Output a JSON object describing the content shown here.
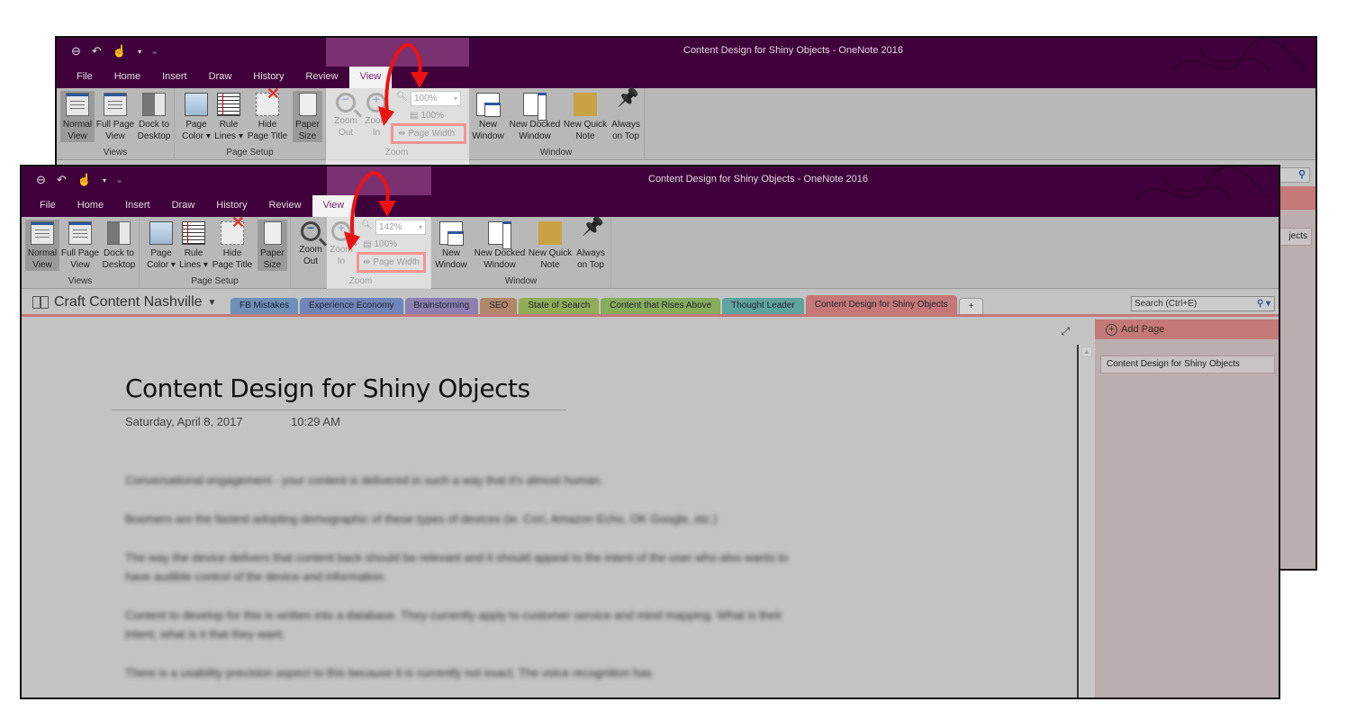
{
  "app": {
    "window_title": "Content Design for Shiny Objects  -  OneNote 2016"
  },
  "quick_access": {
    "back_icon": "back-circle-arrow-icon",
    "undo_icon": "undo-icon",
    "touch_icon": "touch-mode-icon",
    "customize_icon": "customize-qat-icon"
  },
  "menu_tabs": [
    "File",
    "Home",
    "Insert",
    "Draw",
    "History",
    "Review",
    "View"
  ],
  "active_tab": "View",
  "ribbon": {
    "groups": {
      "views": "Views",
      "page_setup": "Page Setup",
      "zoom": "Zoom",
      "window": "Window"
    },
    "buttons": {
      "normal_view": "Normal\nView",
      "full_page_view": "Full Page\nView",
      "dock_to_desktop": "Dock to\nDesktop",
      "page_color": "Page\nColor ▾",
      "rule_lines": "Rule\nLines ▾",
      "hide_page_title": "Hide\nPage Title",
      "paper_size": "Paper\nSize",
      "zoom_out": "Zoom\nOut",
      "zoom_in": "Zoom\nIn",
      "hundred_percent": "100%",
      "page_width": "Page Width",
      "new_window": "New\nWindow",
      "new_docked_window": "New Docked\nWindow",
      "new_quick_note": "New Quick\nNote",
      "always_on_top": "Always\non Top"
    }
  },
  "back_window": {
    "zoom_value": "100%"
  },
  "front_window": {
    "zoom_value": "142%"
  },
  "notebook": {
    "name": "Craft Content Nashville",
    "sections": [
      {
        "label": "FB Mistakes",
        "color": "#6e8fb8"
      },
      {
        "label": "Experience Economy",
        "color": "#6f86b8"
      },
      {
        "label": "Brainstorming",
        "color": "#8c80b0"
      },
      {
        "label": "SEO",
        "color": "#b0876a"
      },
      {
        "label": "State of Search",
        "color": "#90ac58"
      },
      {
        "label": "Content that Rises Above",
        "color": "#86ac5c"
      },
      {
        "label": "Thought Leader",
        "color": "#5ea49c"
      },
      {
        "label": "Content Design for Shiny Objects",
        "color": "#c47878",
        "active": true
      }
    ],
    "add_section": "+"
  },
  "search": {
    "placeholder": "Search (Ctrl+E)"
  },
  "page": {
    "title": "Content Design for Shiny Objects",
    "date": "Saturday, April 8, 2017",
    "time": "10:29 AM",
    "paragraphs": [
      "Conversational engagement - your content is delivered in such a way that it's almost human.",
      "Boomers are the fastest adopting demographic of these types of devices (ie. Cori, Amazon Echo, OK Google, etc.)",
      "The way the device delivers that content back should be relevant and it should appeal to the intent of the user who also wants to have audible control of the device and information.",
      "Content to develop for this is written into a database. They currently apply to customer service and mind mapping. What is their intent, what is it that they want.",
      "There is a usability precision aspect to this because it is currently not exact. The voice recognition has"
    ]
  },
  "pages_pane": {
    "add_page": "Add Page",
    "pages": [
      "Content Design for Shiny Objects"
    ],
    "back_peek_text": "jects"
  },
  "colors": {
    "titlebar": "#3f003b",
    "ribbon": "#b8b8b8",
    "accent_section": "#c47878",
    "annotation_red": "#e11111",
    "view_tab_text": "#7a2a72"
  }
}
